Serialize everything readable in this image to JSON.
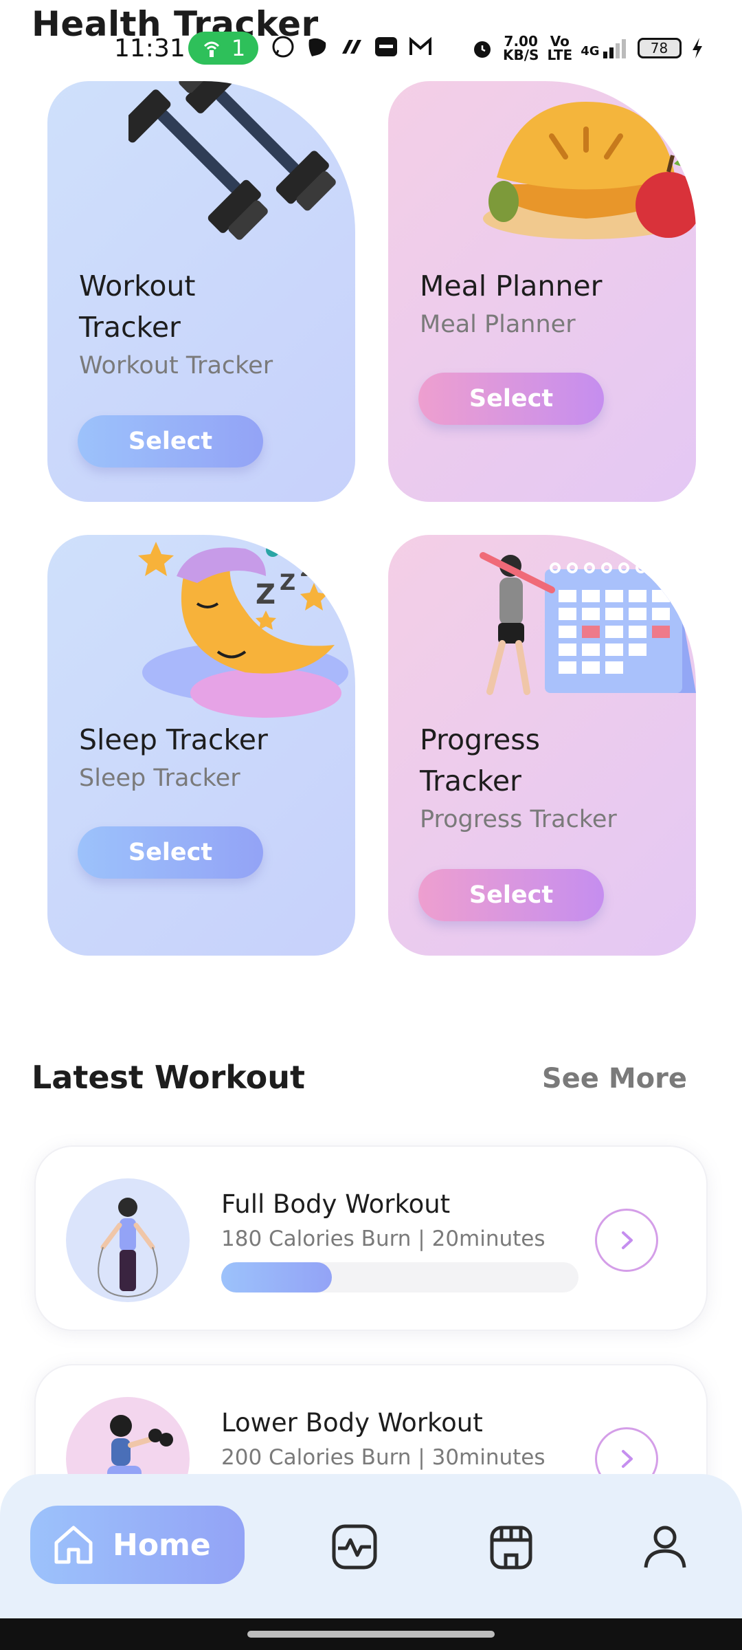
{
  "app": {
    "title": "Health Tracker"
  },
  "status_bar": {
    "time": "11:31",
    "hotspot_count": "1",
    "net_speed_top": "7.00",
    "net_speed_bottom": "KB/S",
    "volte_top": "Vo",
    "volte_bottom": "LTE",
    "network": "4G",
    "battery": "78"
  },
  "cards": [
    {
      "title": "Workout Tracker",
      "subtitle": "Workout Tracker",
      "button": "Select",
      "theme": "blue",
      "art": "dumbbells-icon"
    },
    {
      "title": "Meal Planner",
      "subtitle": "Meal Planner",
      "button": "Select",
      "theme": "pink",
      "art": "pie-apple-icon"
    },
    {
      "title": "Sleep Tracker",
      "subtitle": "Sleep Tracker",
      "button": "Select",
      "theme": "blue",
      "art": "moon-sleep-icon"
    },
    {
      "title": "Progress Tracker",
      "subtitle": "Progress Tracker",
      "button": "Select",
      "theme": "pink",
      "art": "calendar-person-icon"
    }
  ],
  "latest": {
    "title": "Latest Workout",
    "see_more": "See More",
    "items": [
      {
        "name": "Full Body Workout",
        "meta": "180 Calories Burn | 20minutes",
        "progress": 0.31
      },
      {
        "name": "Lower Body Workout",
        "meta": "200 Calories Burn | 30minutes",
        "progress": 0.0
      }
    ]
  },
  "nav": {
    "home_label": "Home",
    "items": [
      "home-icon",
      "activity-icon",
      "store-icon",
      "profile-icon"
    ]
  },
  "colors": {
    "blue_accent": "#93a3f6",
    "pink_accent": "#c58eef",
    "status_green": "#2ec05a"
  }
}
